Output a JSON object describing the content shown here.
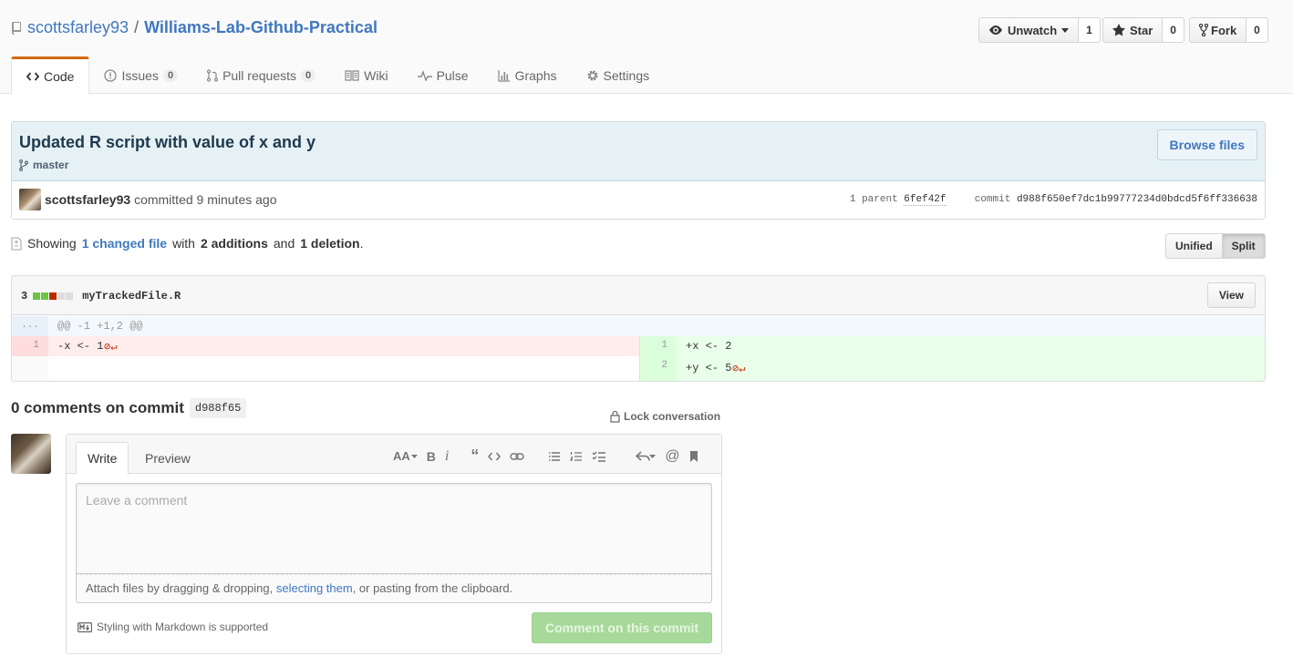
{
  "repo": {
    "owner": "scottsfarley93",
    "separator": "/",
    "name": "Williams-Lab-Github-Practical"
  },
  "actions": [
    {
      "label": "Unwatch",
      "count": "1",
      "icon": "eye-icon"
    },
    {
      "label": "Star",
      "count": "0",
      "icon": "star-icon"
    },
    {
      "label": "Fork",
      "count": "0",
      "icon": "fork-icon"
    }
  ],
  "tabs": [
    {
      "label": "Code",
      "icon": "code-icon",
      "counter": ""
    },
    {
      "label": "Issues",
      "icon": "issue-icon",
      "counter": "0"
    },
    {
      "label": "Pull requests",
      "icon": "pull-request-icon",
      "counter": "0"
    },
    {
      "label": "Wiki",
      "icon": "book-icon",
      "counter": ""
    },
    {
      "label": "Pulse",
      "icon": "pulse-icon",
      "counter": ""
    },
    {
      "label": "Graphs",
      "icon": "graph-icon",
      "counter": ""
    },
    {
      "label": "Settings",
      "icon": "gear-icon",
      "counter": ""
    }
  ],
  "commit": {
    "title": "Updated R script with value of x and y",
    "branch": "master",
    "browse_label": "Browse files",
    "author": "scottsfarley93",
    "action": "committed",
    "time": "9 minutes ago",
    "parent_label": "1 parent",
    "parent_sha": "6fef42f",
    "commit_label": "commit",
    "sha": "d988f650ef7dc1b99777234d0bdcd5f6ff336638"
  },
  "toc": {
    "showing": "Showing",
    "changed": "1 changed file",
    "with": "with",
    "additions": "2 additions",
    "and": "and",
    "deletions": "1 deletion",
    "period": "."
  },
  "view_toggle": {
    "unified": "Unified",
    "split": "Split"
  },
  "file": {
    "stat": "3",
    "name": "myTrackedFile.R",
    "view_label": "View",
    "hunk_dots": "...",
    "hunk_header": "@@ -1 +1,2 @@",
    "left": [
      {
        "num": "1",
        "code": "-x <- 1",
        "noeol": "⊘↵"
      }
    ],
    "right": [
      {
        "num": "1",
        "code": "+x <- 2",
        "noeol": ""
      },
      {
        "num": "2",
        "code": "+y <- 5",
        "noeol": "⊘↵"
      }
    ]
  },
  "comments": {
    "heading": "0 comments on commit",
    "sha": "d988f65",
    "lock_label": "Lock conversation",
    "write_tab": "Write",
    "preview_tab": "Preview",
    "placeholder": "Leave a comment",
    "attach_before": "Attach files by dragging & dropping, ",
    "attach_link": "selecting them",
    "attach_after": ", or pasting from the clipboard.",
    "markdown_note": "Styling with Markdown is supported",
    "submit_label": "Comment on this commit"
  },
  "colors": {
    "link": "#4078c0",
    "added": "#eaffea",
    "deleted": "#ffecec",
    "tab_accent": "#d26911"
  }
}
